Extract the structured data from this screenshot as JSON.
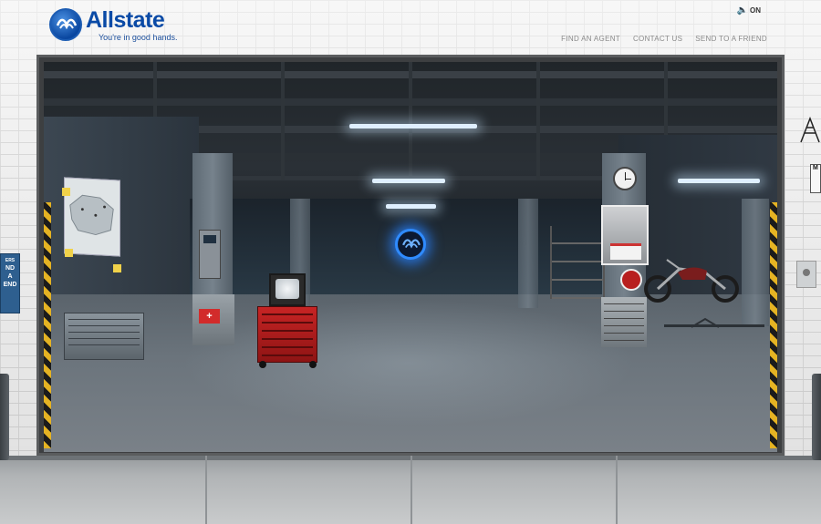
{
  "brand": {
    "name": "Allstate",
    "tagline": "You're in good hands."
  },
  "sound": {
    "label": "ON",
    "icon": "speaker-icon"
  },
  "nav": {
    "items": [
      {
        "label": "FIND AN AGENT"
      },
      {
        "label": "CONTACT US"
      },
      {
        "label": "SEND TO A FRIEND"
      }
    ]
  },
  "left_sign": {
    "top_text": "ERS",
    "main_text": "ND\nA\nEND"
  },
  "right_sign": {
    "text": "M"
  },
  "colors": {
    "brand_blue": "#0a4aa6",
    "toolbox_red": "#c72424",
    "glow_blue": "#2f8bff",
    "hazard_yellow": "#e5b323"
  }
}
